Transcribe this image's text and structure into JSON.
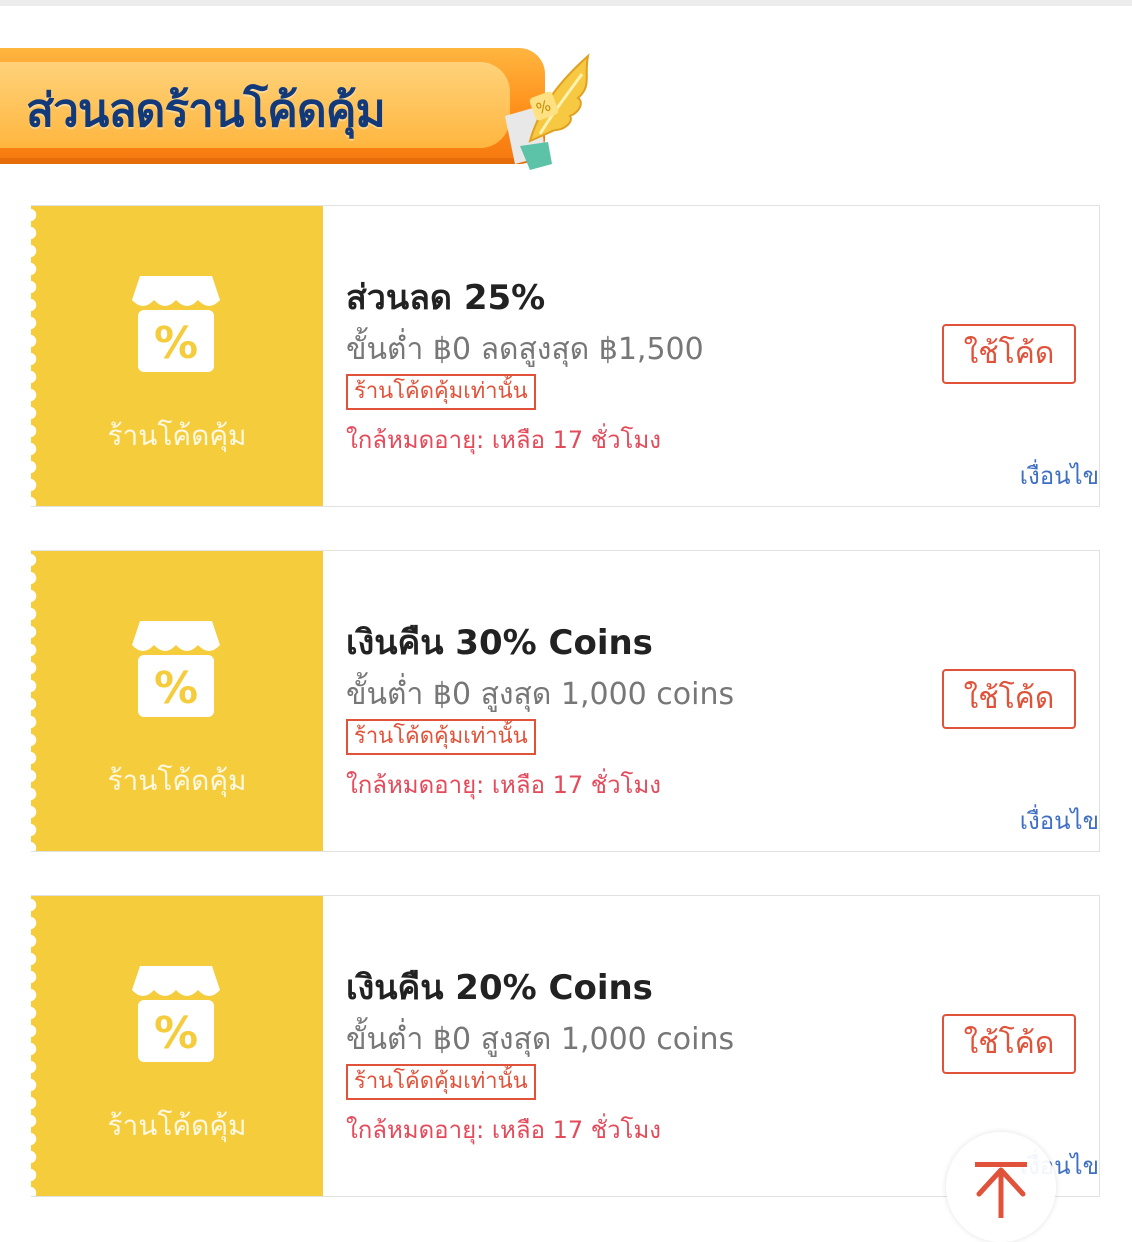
{
  "banner": {
    "title": "ส่วนลดร้านโค้ดคุ้ม",
    "colors": {
      "ribbon": "#ff9a1f",
      "title": "#123a7a"
    }
  },
  "vouchers": [
    {
      "shop_label": "ร้านโค้ดคุ้ม",
      "title": "ส่วนลด 25%",
      "condition": "ขั้นต่ำ ฿0 ลดสูงสุด ฿1,500",
      "badge": "ร้านโค้ดคุ้มเท่านั้น",
      "expiry": "ใกล้หมดอายุ: เหลือ 17 ชั่วโมง",
      "button": "ใช้โค้ด",
      "terms": "เงื่อนไข"
    },
    {
      "shop_label": "ร้านโค้ดคุ้ม",
      "title": "เงินคืน 30% Coins",
      "condition": "ขั้นต่ำ ฿0 สูงสุด 1,000 coins",
      "badge": "ร้านโค้ดคุ้มเท่านั้น",
      "expiry": "ใกล้หมดอายุ: เหลือ 17 ชั่วโมง",
      "button": "ใช้โค้ด",
      "terms": "เงื่อนไข"
    },
    {
      "shop_label": "ร้านโค้ดคุ้ม",
      "title": "เงินคืน 20% Coins",
      "condition": "ขั้นต่ำ ฿0 สูงสุด 1,000 coins",
      "badge": "ร้านโค้ดคุ้มเท่านั้น",
      "expiry": "ใกล้หมดอายุ: เหลือ 17 ชั่วโมง",
      "button": "ใช้โค้ด",
      "terms": "เงื่อนไข"
    }
  ],
  "icons": {
    "shop": "shop-percent-icon",
    "back_to_top": "arrow-up-icon"
  },
  "colors": {
    "voucher_left": "#f5cc3c",
    "accent_red": "#e0533a",
    "expiry": "#e44a5a",
    "link": "#3f6fc4"
  }
}
